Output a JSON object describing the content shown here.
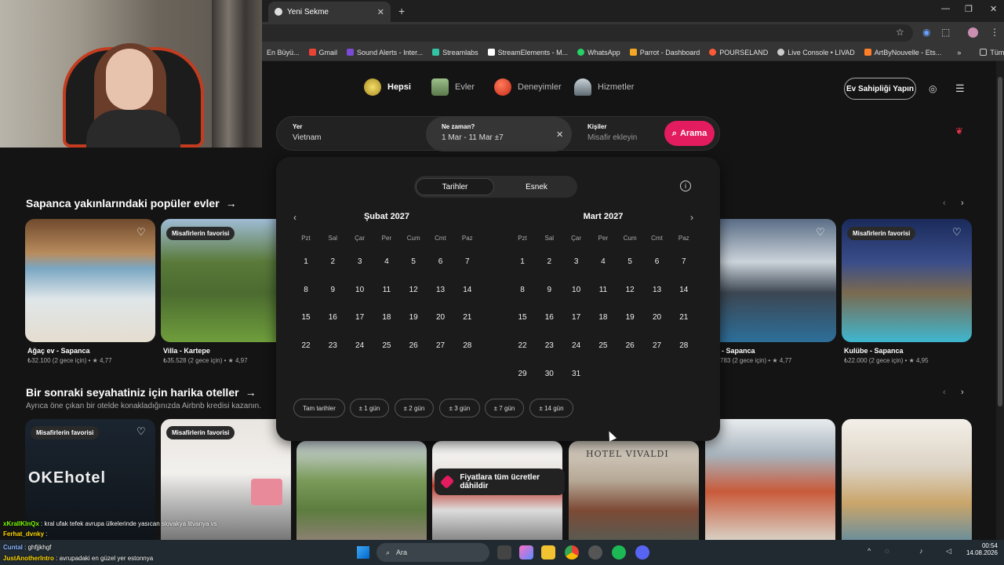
{
  "browser": {
    "tab_title": "Yeni Sekme",
    "bookmarks": [
      "En Büyü...",
      "Gmail",
      "Sound Alerts - Inter...",
      "Streamlabs",
      "StreamElements - M...",
      "WhatsApp",
      "Parrot - Dashboard",
      "POURSELAND",
      "Live Console • LIVAD",
      "ArtByNouvelle - Ets...",
      "»",
      "Tüm Yer İşaretleri"
    ],
    "bookmark_colors": [
      "#555",
      "#ea4335",
      "#7b4ad6",
      "#31c3a2",
      "#ffffff",
      "#25d366",
      "#f5a623",
      "#ff5a36",
      "#cccccc",
      "#ff7f27",
      "#ccc",
      "#ccc"
    ]
  },
  "nav": {
    "categories": [
      {
        "label": "Hepsi",
        "color": "#d9c14a"
      },
      {
        "label": "Evler",
        "color": "#7a9b6a"
      },
      {
        "label": "Deneyimler",
        "color": "#e8452c"
      },
      {
        "label": "Hizmetler",
        "color": "#8c9aa5"
      }
    ],
    "host_button": "Ev Sahipliği Yapın"
  },
  "search": {
    "where_label": "Yer",
    "where_value": "Vietnam",
    "when_label": "Ne zaman?",
    "when_value": "1 Mar - 11 Mar  ±7",
    "who_label": "Kişiler",
    "who_placeholder": "Misafir ekleyin",
    "button": "Arama"
  },
  "calendar": {
    "toggle": [
      "Tarihler",
      "Esnek"
    ],
    "weekdays": [
      "Pzt",
      "Sal",
      "Çar",
      "Per",
      "Cum",
      "Cmt",
      "Paz"
    ],
    "months": [
      {
        "title": "Şubat 2027",
        "start_col": 0,
        "days": 28
      },
      {
        "title": "Mart 2027",
        "start_col": 0,
        "days": 31
      }
    ],
    "chips": [
      "Tam tarihler",
      "± 1 gün",
      "± 2 gün",
      "± 3 gün",
      "± 7 gün",
      "± 14 gün"
    ]
  },
  "section1": {
    "title": "Sapanca yakınlarındaki popüler evler",
    "cards": [
      {
        "title": "Ağaç ev - Sapanca",
        "price": "₺32.100 (2 gece için) • ★ 4,77",
        "badge": ""
      },
      {
        "title": "Villa - Kartepe",
        "price": "₺35.528 (2 gece için) • ★ 4,97",
        "badge": "Misafirlerin favorisi"
      },
      {
        "title": "- Sapanca",
        "price": "783 (2 gece için) • ★ 4,77",
        "badge": ""
      },
      {
        "title": "Kulübe - Sapanca",
        "price": "₺22.000 (2 gece için) • ★ 4,95",
        "badge": "Misafirlerin favorisi"
      }
    ]
  },
  "section2": {
    "title": "Bir sonraki seyahatiniz için harika oteller",
    "subtitle": "Ayrıca öne çıkan bir otelde konakladığınızda Airbnb kredisi kazanın.",
    "badges": [
      "Misafirlerin favorisi",
      "Misafirlerin favorisi"
    ],
    "hotel_sign": "HOTEL VIVALDI",
    "hotel_text": "OKEhotel"
  },
  "tooltip": "Fiyatlara tüm ücretler dâhildir",
  "chat": [
    {
      "user": "xKrallKlnQx",
      "msg": ": kral ufak tefek avrupa ülkelerinde yasıcan slovakya litvanya vs"
    },
    {
      "user": "Ferhat_dvnky",
      "msg": ":"
    },
    {
      "user": "Cuntal",
      "msg": ": ghfjjkhgf"
    },
    {
      "user": "JustAnotherIntro",
      "msg": ": avrupadaki en güzel yer estonnya"
    }
  ],
  "taskbar": {
    "search": "Ara",
    "time": "00:54",
    "date": "14.08.2026"
  }
}
